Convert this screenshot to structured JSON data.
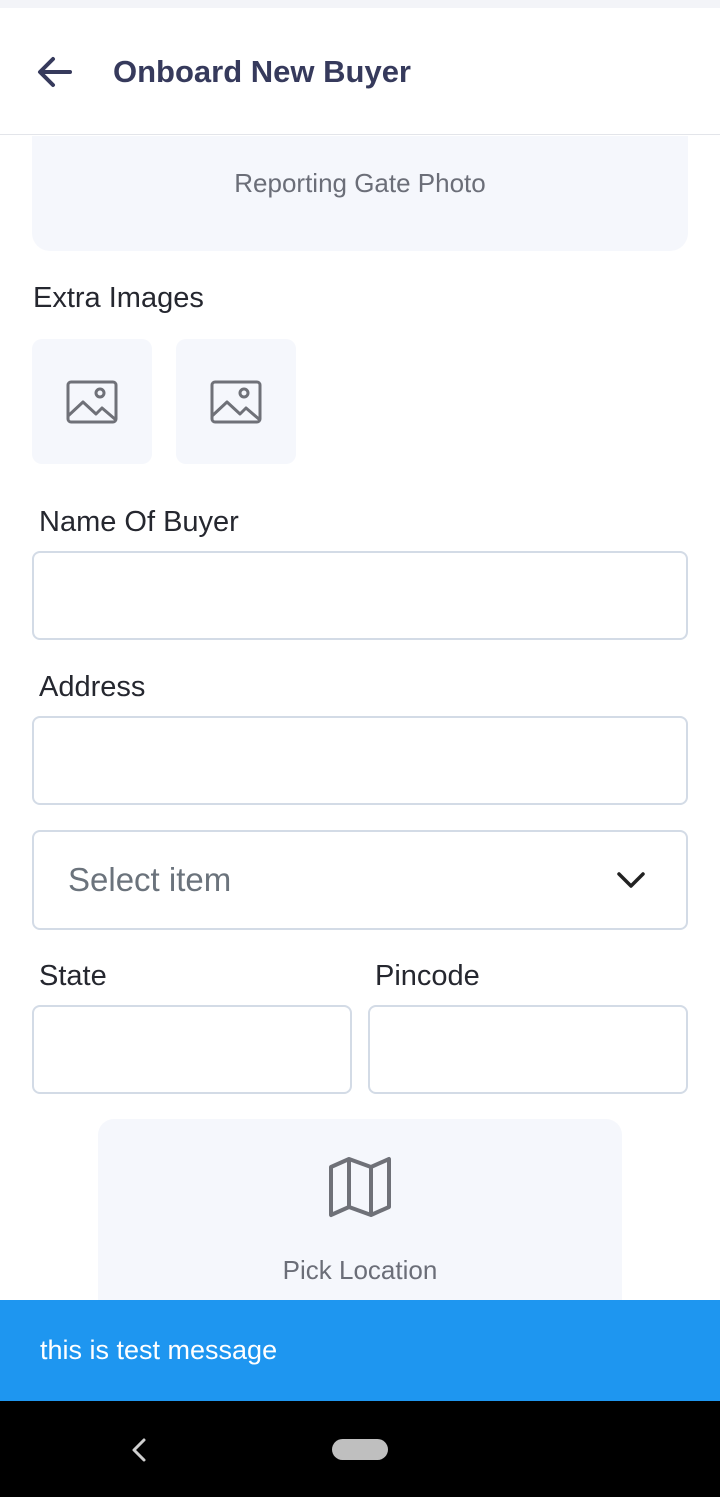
{
  "app_bar": {
    "title": "Onboard New Buyer",
    "back_icon": "arrow-left-icon"
  },
  "gate_photo": {
    "label": "Reporting Gate Photo"
  },
  "extra_images": {
    "label": "Extra Images",
    "thumbnails": [
      {
        "icon": "image-icon"
      },
      {
        "icon": "image-icon"
      }
    ]
  },
  "form": {
    "name_label": "Name Of Buyer",
    "name_value": "",
    "address_label": "Address",
    "address_value": "",
    "select_placeholder": "Select item",
    "select_icon": "chevron-down-icon",
    "state_label": "State",
    "state_value": "",
    "pincode_label": "Pincode",
    "pincode_value": ""
  },
  "pick_location": {
    "icon": "map-icon",
    "label": "Pick Location"
  },
  "snackbar": {
    "message": "this is test message",
    "color": "#1e96f0"
  },
  "colors": {
    "title": "#363a5c",
    "tile_bg": "#f5f7fc",
    "input_border": "#d3dbe6"
  }
}
